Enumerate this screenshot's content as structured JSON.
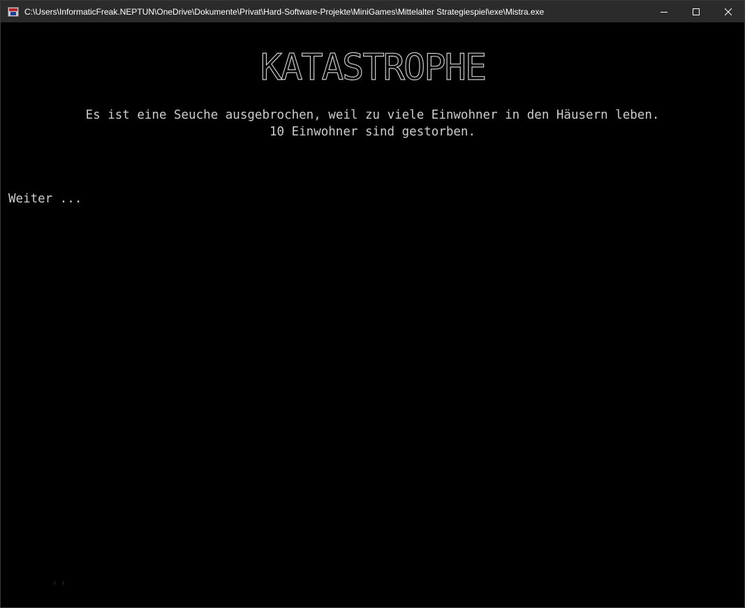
{
  "window": {
    "title": "C:\\Users\\InformaticFreak.NEPTUN\\OneDrive\\Dokumente\\Privat\\Hard-Software-Projekte\\MiniGames\\Mittelalter Strategiespiel\\exe\\Mistra.exe",
    "controls": {
      "minimize_icon": "minimize-icon",
      "maximize_icon": "maximize-icon",
      "close_icon": "close-icon"
    }
  },
  "console": {
    "banner": "KATASTROPHE",
    "message_line_1": "Es ist eine Seuche ausgebrochen, weil zu viele Einwohner in den Häusern leben.",
    "message_line_2": "10 Einwohner sind gestorben.",
    "prompt": "Weiter ..."
  },
  "colors": {
    "titlebar": "#2b2b2b",
    "console_background": "#000000",
    "console_text": "#cccccc"
  }
}
